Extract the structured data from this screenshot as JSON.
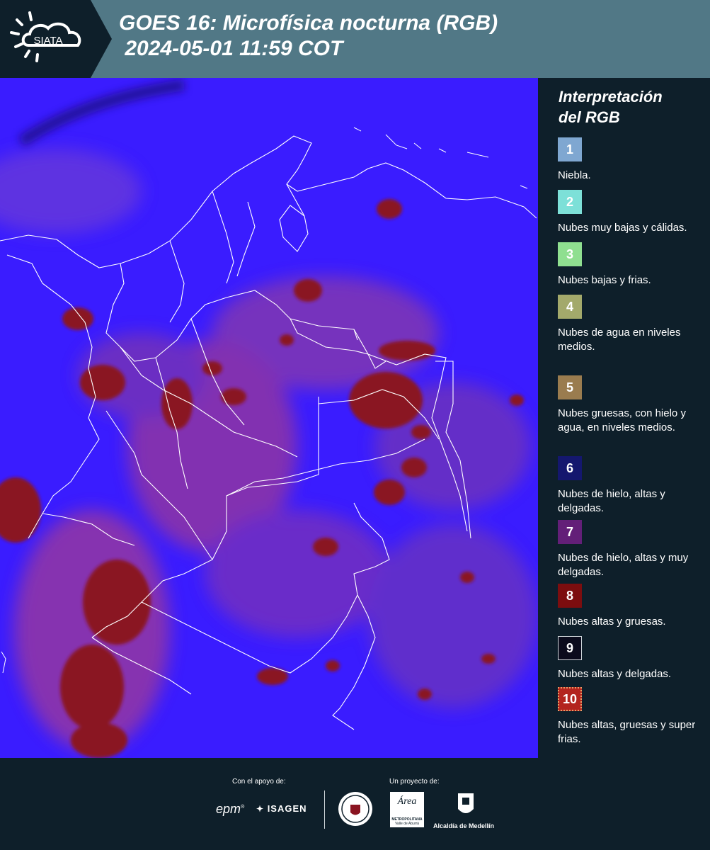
{
  "header": {
    "logo_text": "SIATA",
    "title_line1": "GOES 16: Microfísica nocturna (RGB)",
    "title_line2": " 2024-05-01 11:59 COT"
  },
  "legend": {
    "title": "Interpretación\ndel RGB",
    "items": [
      {
        "num": "1",
        "label": "Niebla.",
        "color": "#7fa7d1"
      },
      {
        "num": "2",
        "label": "Nubes muy bajas y cálidas.",
        "color": "#7de0d8"
      },
      {
        "num": "3",
        "label": "Nubes bajas y frias.",
        "color": "#8fdf90"
      },
      {
        "num": "4",
        "label": "Nubes de agua en niveles medios.",
        "color": "#a3a96b"
      },
      {
        "num": "5",
        "label": "Nubes gruesas, con hielo y agua, en niveles medios.",
        "color": "#9a7c4f"
      },
      {
        "num": "6",
        "label": "Nubes de hielo, altas y delgadas.",
        "color": "#14176e"
      },
      {
        "num": "7",
        "label": "Nubes de hielo, altas y muy delgadas.",
        "color": "#631f78"
      },
      {
        "num": "8",
        "label": "Nubes altas y gruesas.",
        "color": "#7c0d0f"
      },
      {
        "num": "9",
        "label": "Nubes altas y delgadas.",
        "color": "#0b0b1c"
      },
      {
        "num": "10",
        "label": "Nubes altas, gruesas y super frias.",
        "color": "#b3241e"
      }
    ]
  },
  "footer": {
    "support_label": "Con el apoyo de:",
    "project_label": "Un proyecto de:",
    "epm": "epm",
    "isagen": "ISAGEN",
    "area_line1": "Área",
    "area_line2": "METROPOLITANA",
    "area_line3": "Valle de Aburrá",
    "alcaldia": "Alcaldía de Medellín"
  },
  "colors": {
    "header_bg": "#517886",
    "panel_bg": "#0e1f2a",
    "map_blue": "#3a1cff",
    "cloud_red": "#8a1420",
    "cloud_pink": "#b5338a"
  }
}
